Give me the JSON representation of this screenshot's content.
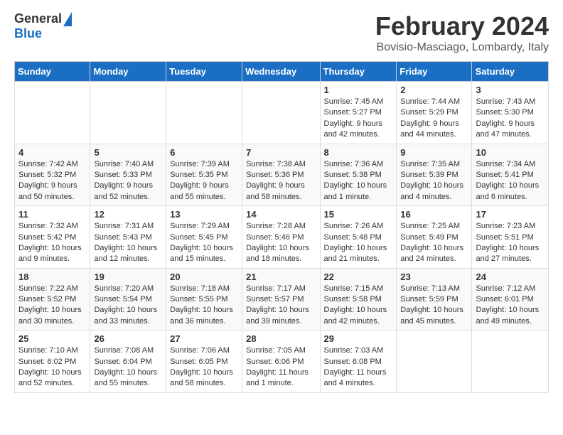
{
  "logo": {
    "general": "General",
    "blue": "Blue"
  },
  "header": {
    "month": "February 2024",
    "location": "Bovisio-Masciago, Lombardy, Italy"
  },
  "weekdays": [
    "Sunday",
    "Monday",
    "Tuesday",
    "Wednesday",
    "Thursday",
    "Friday",
    "Saturday"
  ],
  "weeks": [
    [
      {
        "day": "",
        "info": ""
      },
      {
        "day": "",
        "info": ""
      },
      {
        "day": "",
        "info": ""
      },
      {
        "day": "",
        "info": ""
      },
      {
        "day": "1",
        "info": "Sunrise: 7:45 AM\nSunset: 5:27 PM\nDaylight: 9 hours and 42 minutes."
      },
      {
        "day": "2",
        "info": "Sunrise: 7:44 AM\nSunset: 5:29 PM\nDaylight: 9 hours and 44 minutes."
      },
      {
        "day": "3",
        "info": "Sunrise: 7:43 AM\nSunset: 5:30 PM\nDaylight: 9 hours and 47 minutes."
      }
    ],
    [
      {
        "day": "4",
        "info": "Sunrise: 7:42 AM\nSunset: 5:32 PM\nDaylight: 9 hours and 50 minutes."
      },
      {
        "day": "5",
        "info": "Sunrise: 7:40 AM\nSunset: 5:33 PM\nDaylight: 9 hours and 52 minutes."
      },
      {
        "day": "6",
        "info": "Sunrise: 7:39 AM\nSunset: 5:35 PM\nDaylight: 9 hours and 55 minutes."
      },
      {
        "day": "7",
        "info": "Sunrise: 7:38 AM\nSunset: 5:36 PM\nDaylight: 9 hours and 58 minutes."
      },
      {
        "day": "8",
        "info": "Sunrise: 7:36 AM\nSunset: 5:38 PM\nDaylight: 10 hours and 1 minute."
      },
      {
        "day": "9",
        "info": "Sunrise: 7:35 AM\nSunset: 5:39 PM\nDaylight: 10 hours and 4 minutes."
      },
      {
        "day": "10",
        "info": "Sunrise: 7:34 AM\nSunset: 5:41 PM\nDaylight: 10 hours and 6 minutes."
      }
    ],
    [
      {
        "day": "11",
        "info": "Sunrise: 7:32 AM\nSunset: 5:42 PM\nDaylight: 10 hours and 9 minutes."
      },
      {
        "day": "12",
        "info": "Sunrise: 7:31 AM\nSunset: 5:43 PM\nDaylight: 10 hours and 12 minutes."
      },
      {
        "day": "13",
        "info": "Sunrise: 7:29 AM\nSunset: 5:45 PM\nDaylight: 10 hours and 15 minutes."
      },
      {
        "day": "14",
        "info": "Sunrise: 7:28 AM\nSunset: 5:46 PM\nDaylight: 10 hours and 18 minutes."
      },
      {
        "day": "15",
        "info": "Sunrise: 7:26 AM\nSunset: 5:48 PM\nDaylight: 10 hours and 21 minutes."
      },
      {
        "day": "16",
        "info": "Sunrise: 7:25 AM\nSunset: 5:49 PM\nDaylight: 10 hours and 24 minutes."
      },
      {
        "day": "17",
        "info": "Sunrise: 7:23 AM\nSunset: 5:51 PM\nDaylight: 10 hours and 27 minutes."
      }
    ],
    [
      {
        "day": "18",
        "info": "Sunrise: 7:22 AM\nSunset: 5:52 PM\nDaylight: 10 hours and 30 minutes."
      },
      {
        "day": "19",
        "info": "Sunrise: 7:20 AM\nSunset: 5:54 PM\nDaylight: 10 hours and 33 minutes."
      },
      {
        "day": "20",
        "info": "Sunrise: 7:18 AM\nSunset: 5:55 PM\nDaylight: 10 hours and 36 minutes."
      },
      {
        "day": "21",
        "info": "Sunrise: 7:17 AM\nSunset: 5:57 PM\nDaylight: 10 hours and 39 minutes."
      },
      {
        "day": "22",
        "info": "Sunrise: 7:15 AM\nSunset: 5:58 PM\nDaylight: 10 hours and 42 minutes."
      },
      {
        "day": "23",
        "info": "Sunrise: 7:13 AM\nSunset: 5:59 PM\nDaylight: 10 hours and 45 minutes."
      },
      {
        "day": "24",
        "info": "Sunrise: 7:12 AM\nSunset: 6:01 PM\nDaylight: 10 hours and 49 minutes."
      }
    ],
    [
      {
        "day": "25",
        "info": "Sunrise: 7:10 AM\nSunset: 6:02 PM\nDaylight: 10 hours and 52 minutes."
      },
      {
        "day": "26",
        "info": "Sunrise: 7:08 AM\nSunset: 6:04 PM\nDaylight: 10 hours and 55 minutes."
      },
      {
        "day": "27",
        "info": "Sunrise: 7:06 AM\nSunset: 6:05 PM\nDaylight: 10 hours and 58 minutes."
      },
      {
        "day": "28",
        "info": "Sunrise: 7:05 AM\nSunset: 6:06 PM\nDaylight: 11 hours and 1 minute."
      },
      {
        "day": "29",
        "info": "Sunrise: 7:03 AM\nSunset: 6:08 PM\nDaylight: 11 hours and 4 minutes."
      },
      {
        "day": "",
        "info": ""
      },
      {
        "day": "",
        "info": ""
      }
    ]
  ]
}
